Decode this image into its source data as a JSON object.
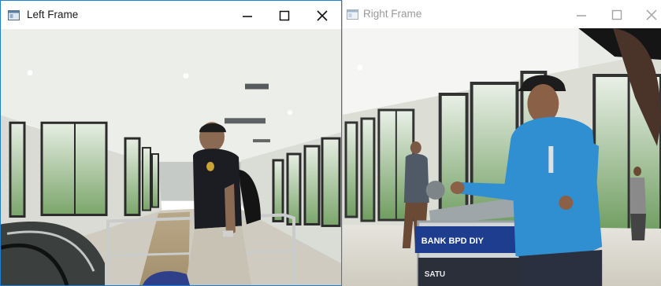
{
  "left_window": {
    "title": "Left Frame",
    "icon": "app-window-icon",
    "controls": [
      "minimize-icon",
      "maximize-icon",
      "close-icon"
    ],
    "active": true
  },
  "right_window": {
    "title": "Right Frame",
    "icon": "app-window-icon",
    "controls": [
      "minimize-icon",
      "maximize-icon",
      "close-icon"
    ],
    "active": false,
    "cart_sign_main": "BANK BPD DIY",
    "cart_sign_lower": "SATU"
  },
  "colors": {
    "active_border": "#1e7fd0",
    "inactive_title": "#9a9a9a"
  }
}
